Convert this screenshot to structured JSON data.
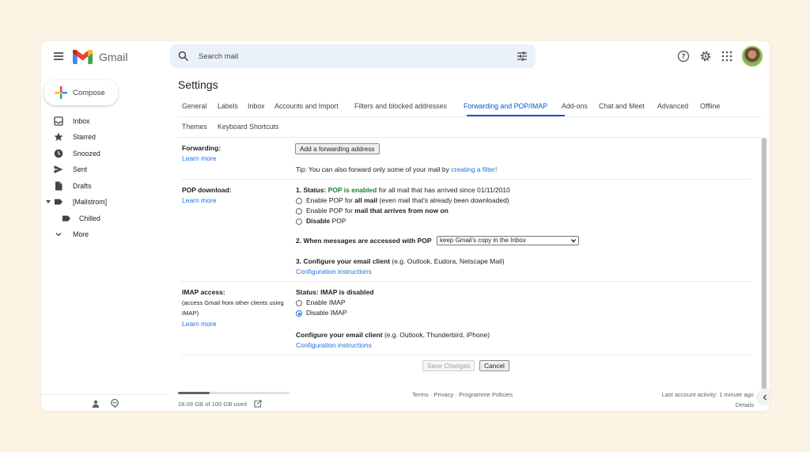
{
  "header": {
    "brand": "Gmail",
    "search_placeholder": "Search mail"
  },
  "compose_label": "Compose",
  "sidebar": {
    "items": [
      {
        "label": "Inbox",
        "icon": "inbox-icon"
      },
      {
        "label": "Starred",
        "icon": "star-icon"
      },
      {
        "label": "Snoozed",
        "icon": "clock-icon"
      },
      {
        "label": "Sent",
        "icon": "send-icon"
      },
      {
        "label": "Drafts",
        "icon": "draft-icon"
      },
      {
        "label": "[Mailstrom]",
        "icon": "label-icon"
      },
      {
        "label": "Chilled",
        "icon": "label-icon"
      },
      {
        "label": "More",
        "icon": "chevron-down-icon"
      }
    ]
  },
  "settings": {
    "title": "Settings",
    "tabs_row1": [
      "General",
      "Labels",
      "Inbox",
      "Accounts and Import",
      "Filters and blocked addresses",
      "Forwarding and POP/IMAP",
      "Add-ons",
      "Chat and Meet",
      "Advanced",
      "Offline"
    ],
    "tabs_row2": [
      "Themes",
      "Keyboard Shortcuts"
    ],
    "active_tab": "Forwarding and POP/IMAP"
  },
  "forwarding": {
    "label": "Forwarding:",
    "learn_more": "Learn more",
    "add_button": "Add a forwarding address",
    "tip_prefix": "Tip: You can also forward only some of your mail by ",
    "tip_link": "creating a filter!"
  },
  "pop": {
    "label": "POP download:",
    "learn_more": "Learn more",
    "status_prefix": "1. Status: ",
    "status_value": "POP is enabled",
    "status_suffix": " for all mail that has arrived since 01/11/2010",
    "opt1_pre": "Enable POP for ",
    "opt1_bold": "all mail",
    "opt1_post": " (even mail that's already been downloaded)",
    "opt2_pre": "Enable POP for ",
    "opt2_bold": "mail that arrives from now on",
    "opt3_bold": "Disable",
    "opt3_post": " POP",
    "when_label": "2. When messages are accessed with POP",
    "when_value": "keep Gmail's copy in the Inbox",
    "configure_bold": "3. Configure your email client",
    "configure_rest": " (e.g. Outlook, Eudora, Netscape Mail)",
    "config_link": "Configuration instructions"
  },
  "imap": {
    "label": "IMAP access:",
    "sub1": "(access Gmail from other clients using",
    "sub2": "IMAP)",
    "learn_more": "Learn more",
    "status": "Status: IMAP is disabled",
    "enable": "Enable IMAP",
    "disable": "Disable IMAP",
    "configure_bold": "Configure your email client",
    "configure_rest": " (e.g. Outlook, Thunderbird, iPhone)",
    "config_link": "Configuration instructions"
  },
  "actions": {
    "save": "Save Changes",
    "cancel": "Cancel"
  },
  "footer": {
    "storage_text": "28.09 GB of 100 GB used",
    "storage_fraction": 0.2809,
    "links": "Terms · Privacy · Programme Policies",
    "last_activity": "Last account activity: 1 minute ago",
    "details": "Details"
  },
  "colors": {
    "accent": "#0b57d0",
    "pop_enabled": "#188038"
  }
}
